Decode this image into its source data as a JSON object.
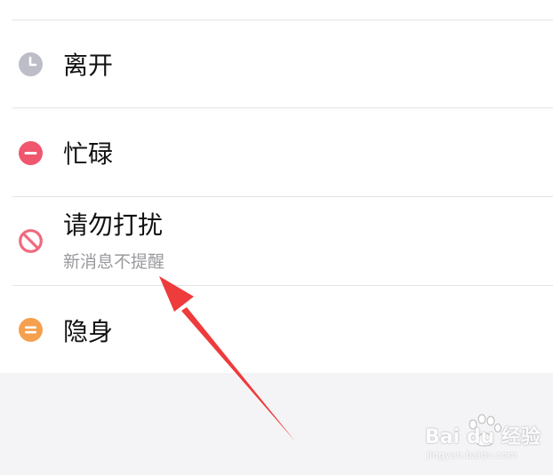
{
  "status_list": {
    "items": [
      {
        "title": "离开",
        "icon": "clock-icon",
        "icon_color": "#bdbdc8"
      },
      {
        "title": "忙碌",
        "icon": "minus-circle-icon",
        "icon_color": "#f0566e"
      },
      {
        "title": "请勿打扰",
        "subtitle": "新消息不提醒",
        "icon": "no-entry-icon",
        "icon_color": "#f06a7e"
      },
      {
        "title": "隐身",
        "icon": "equals-circle-icon",
        "icon_color": "#f5a04f"
      }
    ]
  },
  "annotation": {
    "arrow_color": "#ee3b3b"
  },
  "watermark": {
    "main_text": "Bai du 经验",
    "sub_text": "jingyan.baidu.com"
  }
}
